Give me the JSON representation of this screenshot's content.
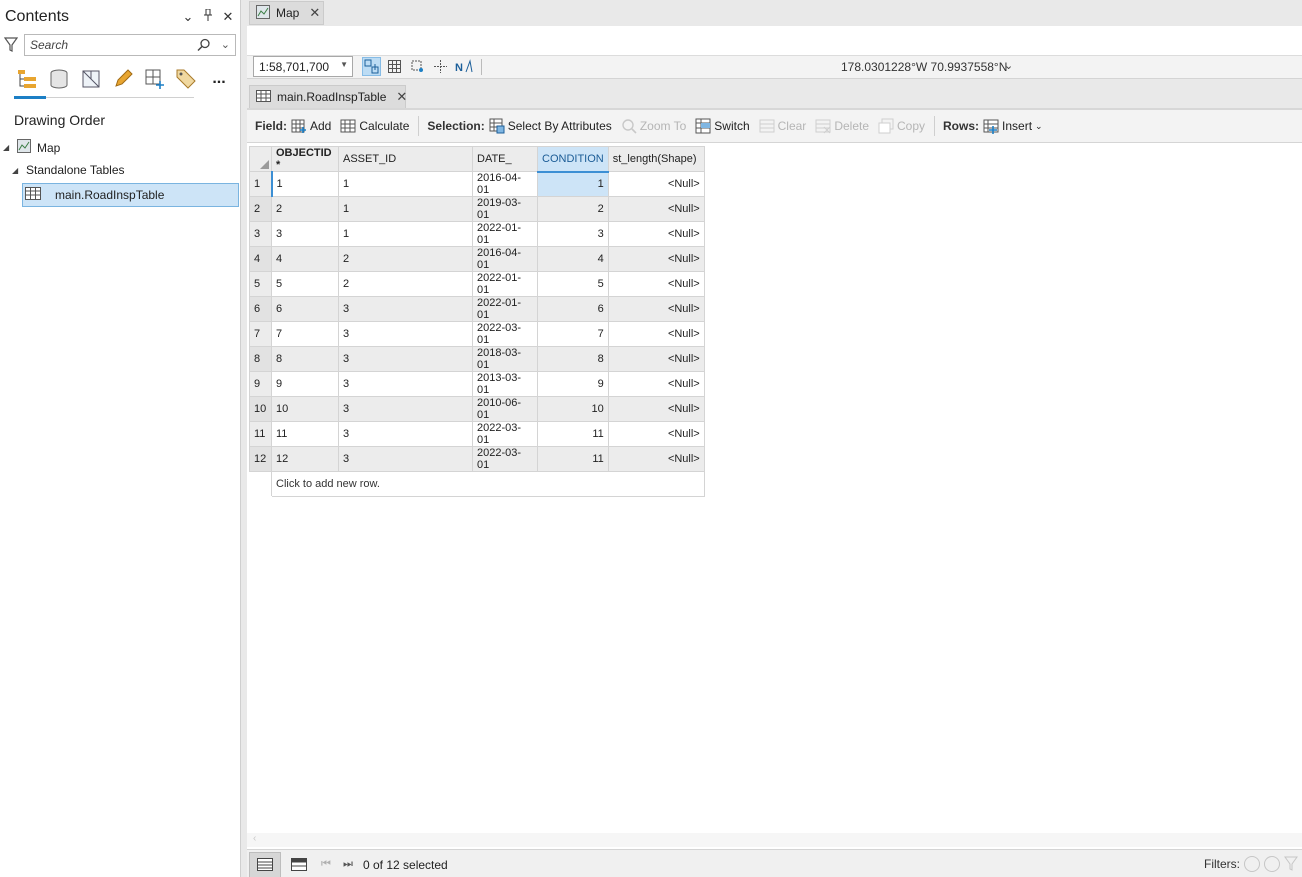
{
  "contents": {
    "title": "Contents",
    "pane_controls": [
      "⌄",
      "📌",
      "✕"
    ],
    "search_placeholder": "Search",
    "drawing_order": "Drawing Order",
    "tree": {
      "map": "Map",
      "standalone_tables": "Standalone Tables",
      "table": "main.RoadInspTable"
    },
    "more_label": "..."
  },
  "tabs": {
    "map": "Map",
    "table": "main.RoadInspTable",
    "close": "✕"
  },
  "map_status": {
    "scale": "1:58,701,700",
    "coordinates": "178.0301228°W 70.9937558°N"
  },
  "toolbar": {
    "field_label": "Field:",
    "add": "Add",
    "calculate": "Calculate",
    "selection_label": "Selection:",
    "select_by_attributes": "Select By Attributes",
    "zoom_to": "Zoom To",
    "switch": "Switch",
    "clear": "Clear",
    "delete": "Delete",
    "copy": "Copy",
    "rows_label": "Rows:",
    "insert": "Insert"
  },
  "grid": {
    "columns": [
      "OBJECTID *",
      "ASSET_ID",
      "DATE_",
      "CONDITION",
      "st_length(Shape)"
    ],
    "rows": [
      [
        "1",
        "1",
        "1",
        "2016-04-01",
        "1",
        "<Null>"
      ],
      [
        "2",
        "2",
        "1",
        "2019-03-01",
        "2",
        "<Null>"
      ],
      [
        "3",
        "3",
        "1",
        "2022-01-01",
        "3",
        "<Null>"
      ],
      [
        "4",
        "4",
        "2",
        "2016-04-01",
        "4",
        "<Null>"
      ],
      [
        "5",
        "5",
        "2",
        "2022-01-01",
        "5",
        "<Null>"
      ],
      [
        "6",
        "6",
        "3",
        "2022-01-01",
        "6",
        "<Null>"
      ],
      [
        "7",
        "7",
        "3",
        "2022-03-01",
        "7",
        "<Null>"
      ],
      [
        "8",
        "8",
        "3",
        "2018-03-01",
        "8",
        "<Null>"
      ],
      [
        "9",
        "9",
        "3",
        "2013-03-01",
        "9",
        "<Null>"
      ],
      [
        "10",
        "10",
        "3",
        "2010-06-01",
        "10",
        "<Null>"
      ],
      [
        "11",
        "11",
        "3",
        "2022-03-01",
        "11",
        "<Null>"
      ],
      [
        "12",
        "12",
        "3",
        "2022-03-01",
        "11",
        "<Null>"
      ]
    ],
    "add_row_text": "Click to add new row."
  },
  "footer": {
    "selected_text": "0 of 12 selected",
    "filters_label": "Filters:"
  },
  "colors": {
    "accent": "#1c7fc5",
    "selection": "#cde4f7"
  }
}
